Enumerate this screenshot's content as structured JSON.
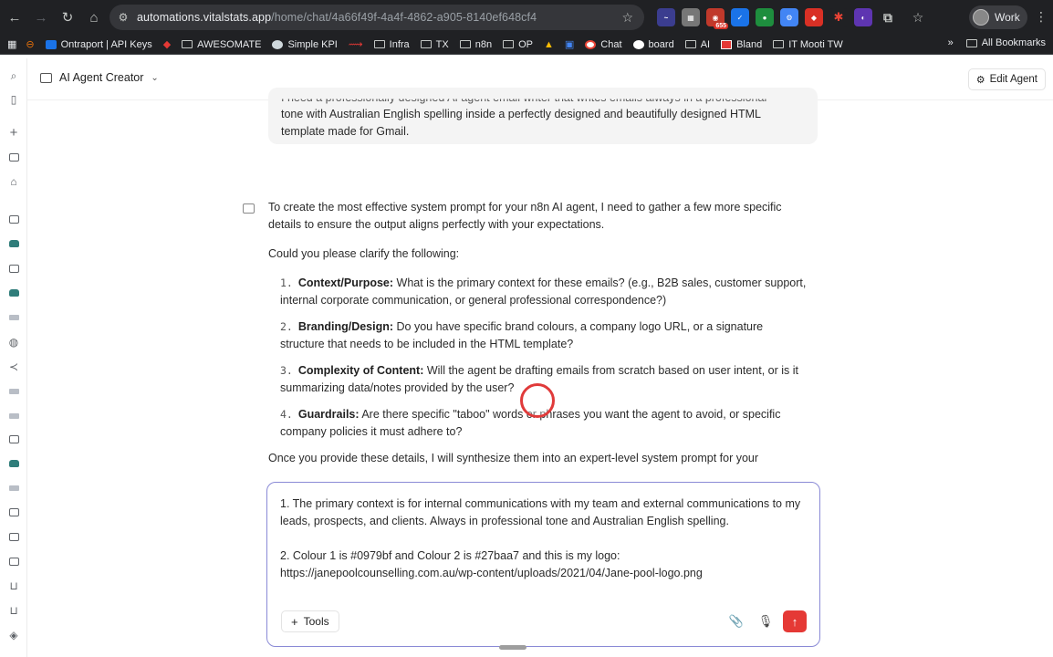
{
  "browser": {
    "url_host": "automations.vitalstats.app",
    "url_path": "/home/chat/4a66f49f-4a4f-4862-a905-8140ef648cf4",
    "extension_badges": [
      "655"
    ],
    "profile_label": "Work"
  },
  "bookmarks": {
    "items": [
      "Ontraport | API Keys",
      "AWESOMATE",
      "Simple KPI",
      "Infra",
      "TX",
      "n8n",
      "OP",
      "Chat",
      "board",
      "AI",
      "Bland",
      "IT Mooti TW"
    ],
    "overflow": "»",
    "all_label": "All Bookmarks"
  },
  "header": {
    "agent_name": "AI Agent Creator",
    "edit_label": "Edit Agent"
  },
  "conversation": {
    "user_cut_line": "I need a professionally designed AI agent email writer that writes emails always in a professional",
    "user_message": "tone with Australian English spelling inside a perfectly designed and beautifully designed HTML template made for Gmail.",
    "intro": "To create the most effective system prompt for your n8n AI agent, I need to gather a few more specific details to ensure the output aligns perfectly with your expectations.",
    "ask": "Could you please clarify the following:",
    "questions": [
      {
        "num": "1.",
        "title": "Context/Purpose:",
        "text": "What is the primary context for these emails? (e.g., B2B sales, customer support, internal corporate communication, or general professional correspondence?)"
      },
      {
        "num": "2.",
        "title": "Branding/Design:",
        "text": "Do you have specific brand colours, a company logo URL, or a signature structure that needs to be included in the HTML template?"
      },
      {
        "num": "3.",
        "title": "Complexity of Content:",
        "text": "Will the agent be drafting emails from scratch based on user intent, or is it summarizing data/notes provided by the user?"
      },
      {
        "num": "4.",
        "title": "Guardrails:",
        "text": "Are there specific \"taboo\" words or phrases you want the agent to avoid, or specific company policies it must adhere to?"
      }
    ],
    "outro": "Once you provide these details, I will synthesize them into an expert-level system prompt for your"
  },
  "composer": {
    "draft": "1. The primary context is for internal communications with my team and external communications to my leads, prospects, and clients. Always in professional tone and Australian English spelling.\n\n2. Colour 1 is #0979bf and Colour 2 is #27baa7 and this is my logo:\nhttps://janepoolcounselling.com.au/wp-content/uploads/2021/04/Jane-pool-logo.png",
    "tools_label": "Tools",
    "accent_color": "#e53935"
  }
}
